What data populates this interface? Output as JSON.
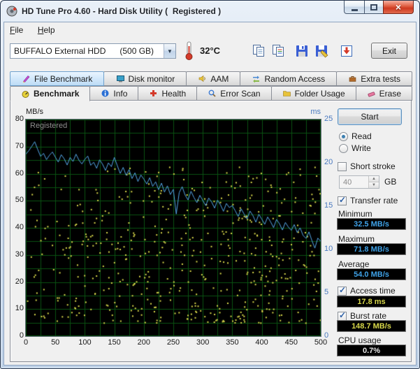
{
  "window": {
    "title": "HD Tune Pro 4.60 - Hard Disk Utility (  Registered )",
    "app_icon": "hd-tune-icon"
  },
  "menu": {
    "items": [
      "File",
      "Help"
    ]
  },
  "toolbar": {
    "drive_combo": {
      "value": "BUFFALO External HDD      (500 GB)"
    },
    "temperature": "32°C",
    "icons": [
      "thermometer-icon",
      "copy-screenshot-icon",
      "copy-text-icon",
      "save-screenshot-icon",
      "save-text-icon",
      "update-icon"
    ],
    "exit_label": "Exit"
  },
  "tabs": {
    "row1": [
      {
        "label": "File Benchmark",
        "icon": "file-benchmark-icon",
        "highlighted": true
      },
      {
        "label": "Disk monitor",
        "icon": "disk-monitor-icon"
      },
      {
        "label": "AAM",
        "icon": "aam-icon"
      },
      {
        "label": "Random Access",
        "icon": "random-access-icon"
      },
      {
        "label": "Extra tests",
        "icon": "extra-tests-icon"
      }
    ],
    "row2": [
      {
        "label": "Benchmark",
        "icon": "benchmark-icon",
        "active": true
      },
      {
        "label": "Info",
        "icon": "info-icon"
      },
      {
        "label": "Health",
        "icon": "health-icon"
      },
      {
        "label": "Error Scan",
        "icon": "error-scan-icon"
      },
      {
        "label": "Folder Usage",
        "icon": "folder-usage-icon"
      },
      {
        "label": "Erase",
        "icon": "erase-icon"
      }
    ]
  },
  "controls": {
    "start_label": "Start",
    "mode": {
      "read_label": "Read",
      "write_label": "Write",
      "selected": "Read"
    },
    "short_stroke": {
      "label": "Short stroke",
      "checked": false,
      "value": "40",
      "unit": "GB"
    },
    "transfer_rate": {
      "label": "Transfer rate",
      "checked": true,
      "minimum_label": "Minimum",
      "minimum_value": "32.5 MB/s",
      "maximum_label": "Maximum",
      "maximum_value": "71.8 MB/s",
      "average_label": "Average",
      "average_value": "54.0 MB/s"
    },
    "access_time": {
      "label": "Access time",
      "checked": true,
      "value": "17.8 ms"
    },
    "burst_rate": {
      "label": "Burst rate",
      "checked": true,
      "value": "148.7 MB/s"
    },
    "cpu_usage": {
      "label": "CPU usage",
      "value": "0.7%"
    }
  },
  "chart_data": {
    "type": "line",
    "watermark": "Registered",
    "x_range": [
      0,
      500
    ],
    "x_ticks": [
      0,
      50,
      100,
      150,
      200,
      250,
      300,
      350,
      400,
      450,
      500
    ],
    "y_left_label": "MB/s",
    "y_left_range": [
      0,
      80
    ],
    "y_left_ticks": [
      80,
      70,
      60,
      50,
      40,
      30,
      20,
      10,
      0
    ],
    "y_right_label": "ms",
    "y_right_range": [
      0,
      25
    ],
    "y_right_ticks": [
      25,
      20,
      15,
      10,
      5,
      0
    ],
    "grid": {
      "x_step": 25,
      "y_step": 5,
      "color": "#0a5212",
      "background": "#000000"
    },
    "series": [
      {
        "name": "transfer-rate",
        "type": "line",
        "color": "#55a8e8",
        "x_step": 5,
        "values": [
          67.2,
          68.5,
          70.1,
          71.8,
          69.0,
          66.4,
          67.5,
          65.2,
          66.8,
          68.0,
          66.1,
          64.3,
          67.0,
          65.5,
          63.2,
          66.0,
          64.5,
          67.2,
          65.0,
          63.6,
          65.3,
          66.5,
          63.1,
          64.2,
          62.0,
          65.1,
          63.5,
          61.2,
          64.0,
          62.6,
          66.0,
          63.0,
          60.1,
          62.3,
          59.4,
          61.5,
          58.2,
          60.3,
          57.1,
          59.5,
          58.0,
          56.2,
          58.5,
          55.3,
          57.0,
          54.1,
          56.5,
          53.2,
          55.5,
          52.3,
          54.2,
          45.1,
          53.0,
          55.2,
          52.1,
          50.3,
          53.5,
          51.2,
          49.3,
          52.0,
          50.1,
          48.2,
          51.0,
          49.5,
          47.3,
          50.2,
          48.5,
          46.1,
          49.0,
          47.5,
          48.2,
          46.3,
          44.2,
          47.0,
          45.1,
          43.3,
          46.2,
          44.5,
          42.1,
          45.0,
          43.2,
          41.3,
          44.0,
          42.2,
          40.1,
          43.1,
          41.5,
          39.2,
          42.0,
          40.3,
          39.1,
          41.2,
          38.3,
          40.0,
          37.2,
          36.1,
          38.5,
          35.3,
          32.5,
          36.2,
          35.0
        ]
      },
      {
        "name": "access-time",
        "type": "scatter",
        "color": "#d8d84a",
        "point_count": 520,
        "seed": 4600532,
        "ms_min": 1.5,
        "ms_max": 19.5,
        "distribution_pow": 1.25
      }
    ],
    "summary": {
      "minimum_mbs": 32.5,
      "maximum_mbs": 71.8,
      "average_mbs": 54.0,
      "access_time_ms": 17.8,
      "burst_rate_mbs": 148.7,
      "cpu_usage_pct": 0.7
    }
  }
}
